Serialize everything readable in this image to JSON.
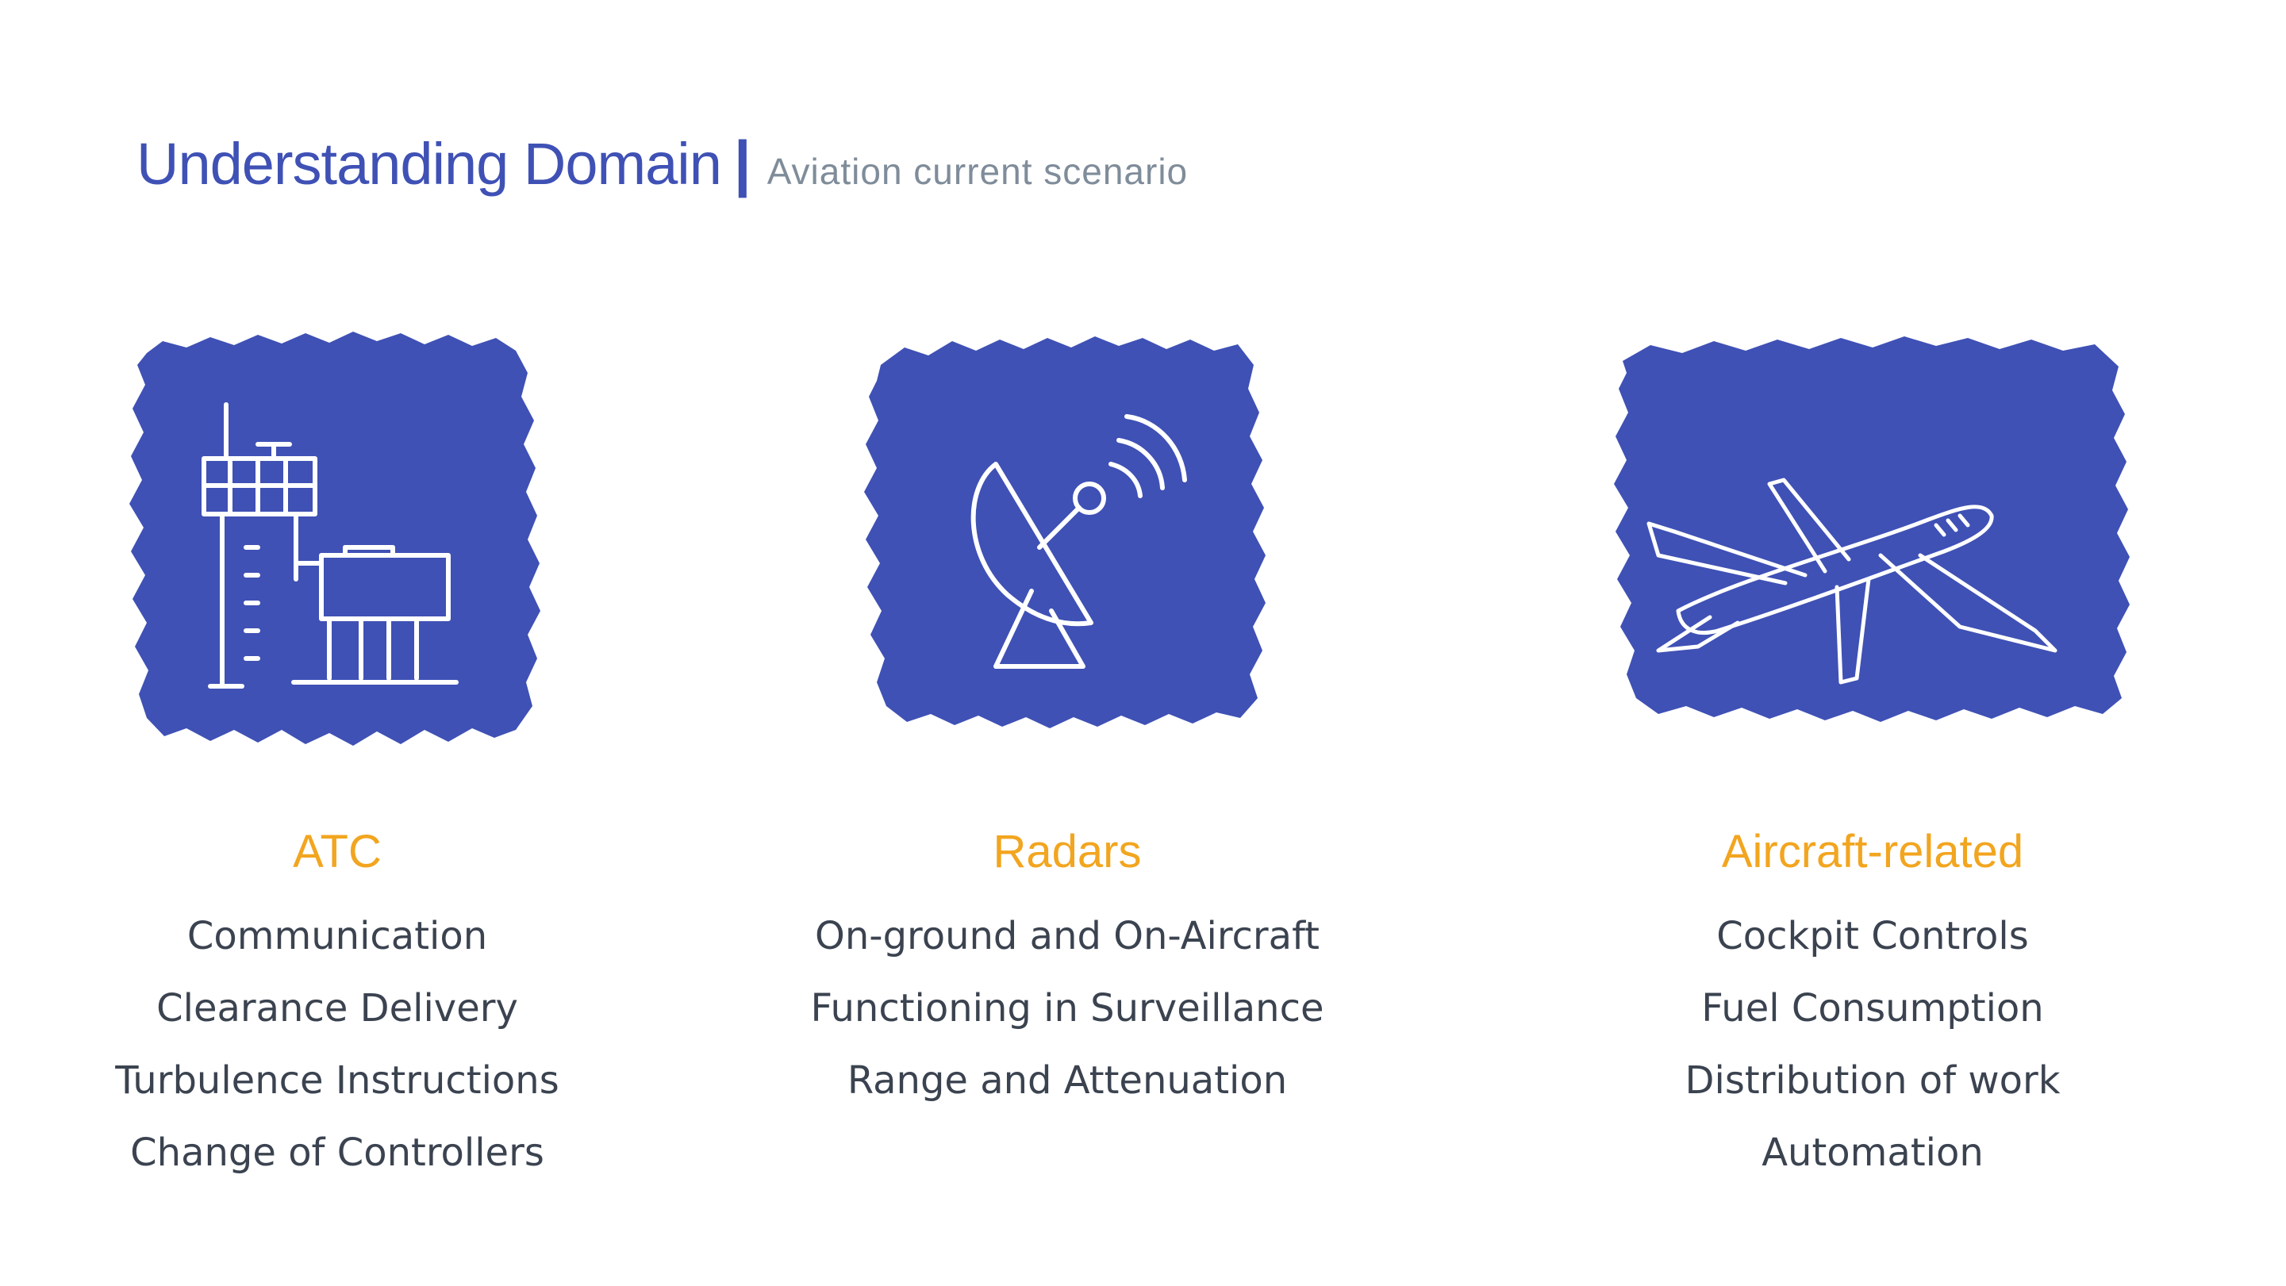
{
  "header": {
    "title": "Understanding Domain",
    "divider": "|",
    "subtitle": "Aviation current scenario"
  },
  "colors": {
    "primary": "#3f51b5",
    "accent": "#f2a51f",
    "subtitle": "#7f8c9a",
    "body_text": "#3b4350"
  },
  "columns": [
    {
      "icon": "control-tower-icon",
      "title": "ATC",
      "items": [
        "Communication",
        "Clearance Delivery",
        "Turbulence Instructions",
        "Change of Controllers"
      ]
    },
    {
      "icon": "satellite-dish-icon",
      "title": "Radars",
      "items": [
        "On-ground and On-Aircraft",
        "Functioning in Surveillance",
        "Range and Attenuation"
      ]
    },
    {
      "icon": "airplane-icon",
      "title": "Aircraft-related",
      "items": [
        "Cockpit Controls",
        "Fuel Consumption",
        "Distribution of work",
        "Automation"
      ]
    }
  ]
}
